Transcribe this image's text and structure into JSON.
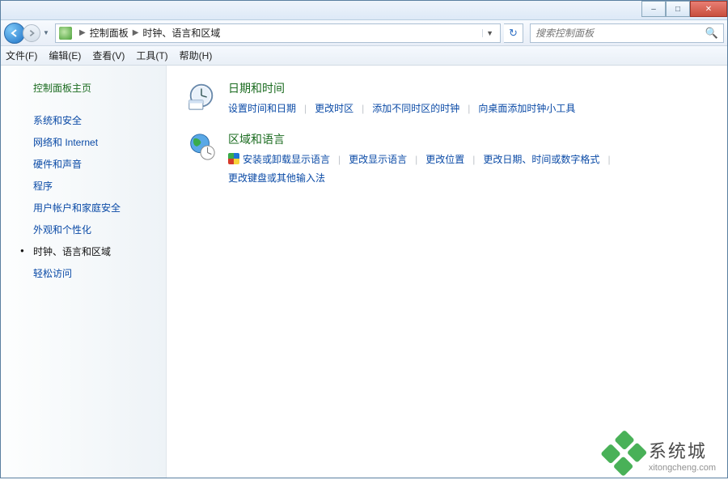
{
  "window": {
    "minimize": "–",
    "maximize": "□",
    "close": "✕"
  },
  "breadcrumb": {
    "root": "控制面板",
    "current": "时钟、语言和区域"
  },
  "nav": {
    "refresh": "↻"
  },
  "search": {
    "placeholder": "搜索控制面板"
  },
  "menu": {
    "file": "文件(F)",
    "edit": "编辑(E)",
    "view": "查看(V)",
    "tools": "工具(T)",
    "help": "帮助(H)"
  },
  "sidebar": {
    "home": "控制面板主页",
    "items": [
      "系统和安全",
      "网络和 Internet",
      "硬件和声音",
      "程序",
      "用户帐户和家庭安全",
      "外观和个性化",
      "时钟、语言和区域",
      "轻松访问"
    ],
    "activeIndex": 6
  },
  "content": {
    "section1": {
      "title": "日期和时间",
      "links": [
        "设置时间和日期",
        "更改时区",
        "添加不同时区的时钟",
        "向桌面添加时钟小工具"
      ]
    },
    "section2": {
      "title": "区域和语言",
      "links": [
        "安装或卸载显示语言",
        "更改显示语言",
        "更改位置",
        "更改日期、时间或数字格式",
        "更改键盘或其他输入法"
      ],
      "shieldIndex": 0
    }
  },
  "watermark": {
    "title": "系统城",
    "sub": "xitongcheng.com"
  }
}
